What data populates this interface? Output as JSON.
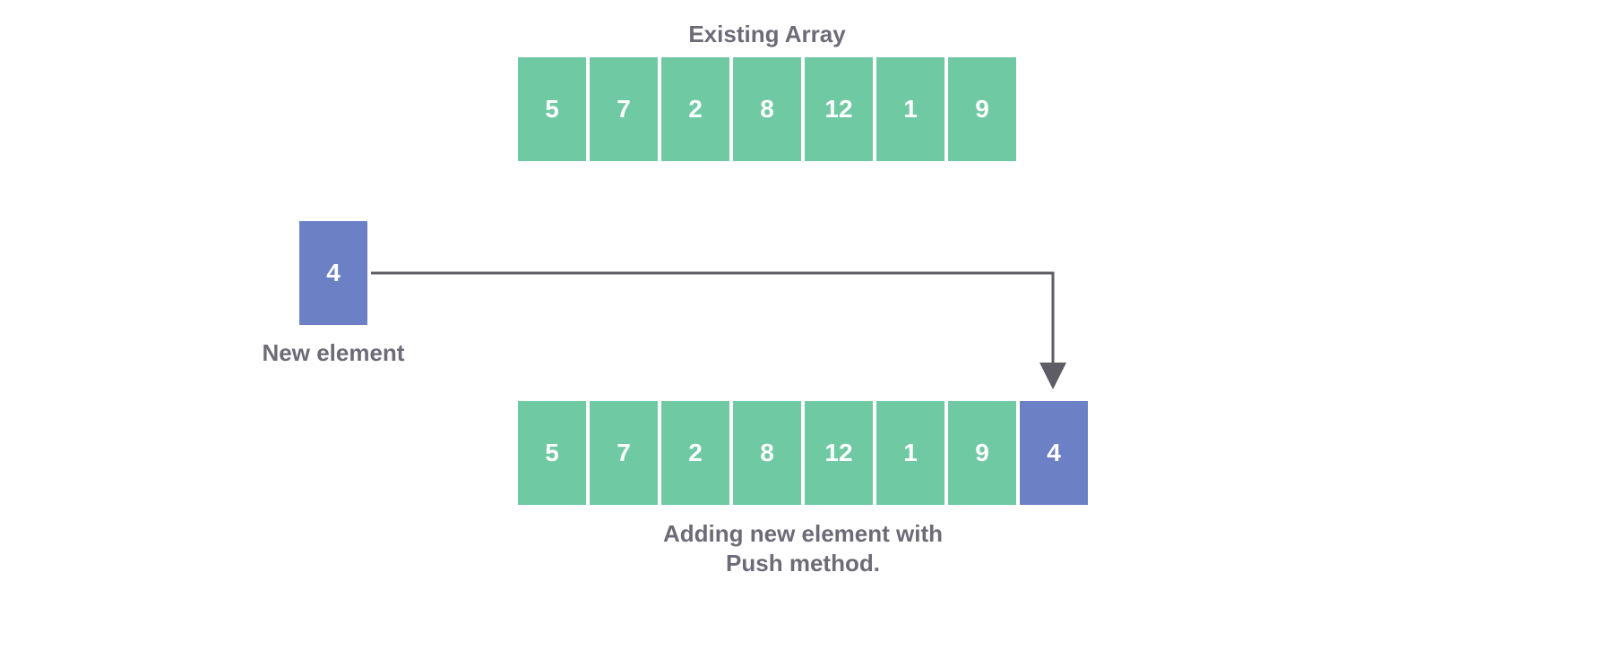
{
  "labels": {
    "existing_array": "Existing Array",
    "new_element": "New element",
    "result_line1": "Adding new element with",
    "result_line2": "Push method."
  },
  "existing_array": {
    "values": [
      "5",
      "7",
      "2",
      "8",
      "12",
      "1",
      "9"
    ]
  },
  "new_element": {
    "value": "4"
  },
  "result_array": {
    "values": [
      "5",
      "7",
      "2",
      "8",
      "12",
      "1",
      "9",
      "4"
    ],
    "new_index": 7
  },
  "colors": {
    "existing": "#6fc9a3",
    "new": "#6c80c5",
    "text": "#6c6b77",
    "arrow": "#5e5d66"
  }
}
